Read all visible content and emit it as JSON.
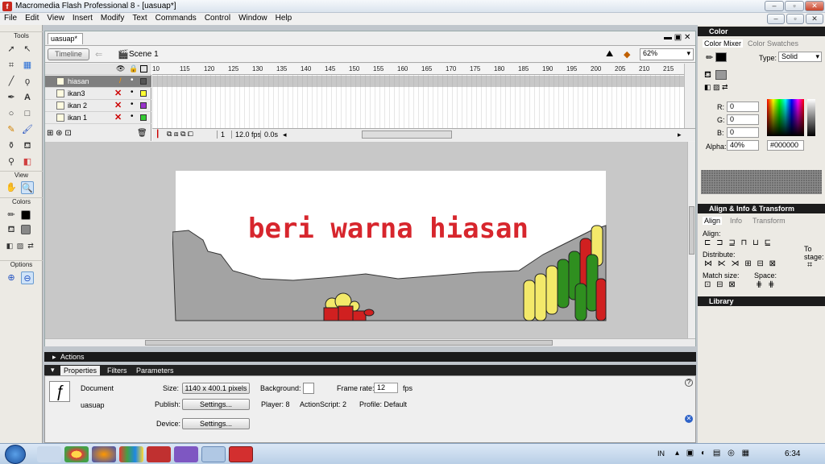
{
  "window": {
    "title": "Macromedia Flash Professional 8 - [uasuap*]",
    "app_icon": "f"
  },
  "menu": [
    "File",
    "Edit",
    "View",
    "Insert",
    "Modify",
    "Text",
    "Commands",
    "Control",
    "Window",
    "Help"
  ],
  "tools": {
    "header": "Tools",
    "view_header": "View",
    "colors_header": "Colors",
    "options_header": "Options"
  },
  "document": {
    "tab": "uasuap*",
    "timeline_button": "Timeline",
    "scene": "Scene 1",
    "zoom": "62%"
  },
  "timeline": {
    "layers": [
      {
        "name": "hiasan",
        "color": "#555555",
        "selected": true
      },
      {
        "name": "ikan3",
        "color": "#ffff33",
        "selected": false
      },
      {
        "name": "ikan 2",
        "color": "#9933cc",
        "selected": false
      },
      {
        "name": "ikan 1",
        "color": "#33cc33",
        "selected": false
      }
    ],
    "ruler": [
      "10",
      "115",
      "120",
      "125",
      "130",
      "135",
      "140",
      "145",
      "150",
      "155",
      "160",
      "165",
      "170",
      "175",
      "180",
      "185",
      "190",
      "195",
      "200",
      "205",
      "210",
      "215",
      "2"
    ],
    "current_frame": "1",
    "frame_rate": "12.0 fps",
    "elapsed": "0.0s"
  },
  "stage": {
    "text": "beri warna hiasan",
    "text_color": "#d7262d"
  },
  "panels": {
    "actions": "Actions",
    "properties_tab": "Properties",
    "filters_tab": "Filters",
    "parameters_tab": "Parameters"
  },
  "properties": {
    "doc_label": "Document",
    "doc_name": "uasuap",
    "size_label": "Size:",
    "size_value": "1140 x 400.1 pixels",
    "background_label": "Background:",
    "frame_rate_label": "Frame rate:",
    "frame_rate_value": "12",
    "fps": "fps",
    "publish_label": "Publish:",
    "settings_btn": "Settings...",
    "player": "Player: 8",
    "actionscript": "ActionScript: 2",
    "profile": "Profile: Default",
    "device_label": "Device:",
    "device_btn": "Settings..."
  },
  "color_panel": {
    "header": "Color",
    "tab_mixer": "Color Mixer",
    "tab_swatches": "Color Swatches",
    "type_label": "Type:",
    "type_value": "Solid",
    "r_label": "R:",
    "r": "0",
    "g_label": "G:",
    "g": "0",
    "b_label": "B:",
    "b": "0",
    "alpha_label": "Alpha:",
    "alpha": "40%",
    "hex": "#000000"
  },
  "align_panel": {
    "header": "Align & Info & Transform",
    "tab_align": "Align",
    "tab_info": "Info",
    "tab_transform": "Transform",
    "align_label": "Align:",
    "distribute_label": "Distribute:",
    "match_label": "Match size:",
    "space_label": "Space:",
    "to_stage": "To stage:"
  },
  "library": {
    "header": "Library"
  },
  "taskbar": {
    "clock": "6:34",
    "lang": "IN"
  }
}
